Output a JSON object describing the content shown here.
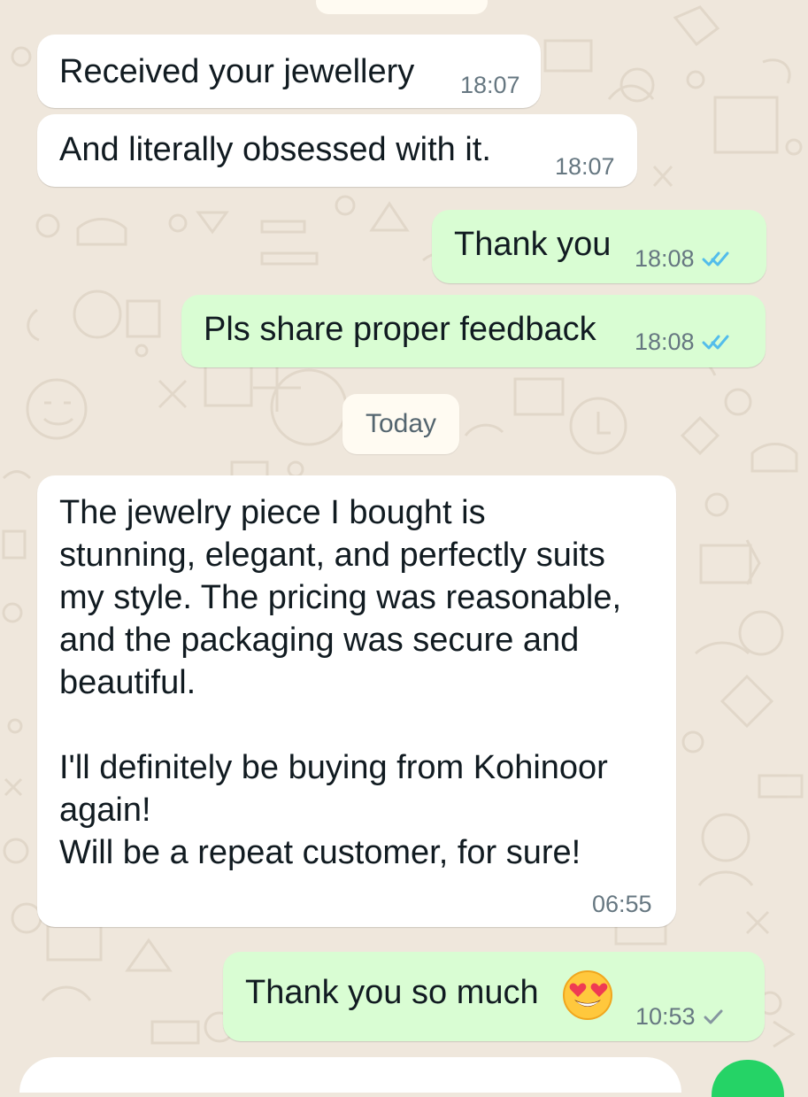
{
  "colors": {
    "wallpaper": "#efe7dc",
    "incoming_bubble": "#ffffff",
    "outgoing_bubble": "#d9fdd3",
    "timestamp": "#667781",
    "read_ticks": "#53bdeb",
    "sent_tick": "#8696a0",
    "date_chip": "#fffbf2",
    "send_button": "#25d366"
  },
  "messages": [
    {
      "direction": "incoming",
      "text": "Received your jewellery",
      "time": "18:07"
    },
    {
      "direction": "incoming",
      "text": "And literally obsessed with it.",
      "time": "18:07"
    },
    {
      "direction": "outgoing",
      "text": "Thank you",
      "time": "18:08",
      "status": "read",
      "status_icon": "double-check-icon"
    },
    {
      "direction": "outgoing",
      "text": "Pls share proper feedback",
      "time": "18:08",
      "status": "read",
      "status_icon": "double-check-icon"
    },
    {
      "direction": "incoming",
      "text": "The jewelry piece I bought is\nstunning, elegant, and perfectly suits\nmy style. The pricing was reasonable,\nand the packaging was secure and\nbeautiful.\n\nI'll definitely be buying from Kohinoor\nagain!\nWill be a repeat customer, for sure!",
      "time": "06:55"
    },
    {
      "direction": "outgoing",
      "text": "Thank you so much",
      "time": "10:53",
      "status": "sent",
      "status_icon": "single-check-icon",
      "emoji": "smiling-face-with-heart-eyes-icon"
    }
  ],
  "date_separator": "Today"
}
